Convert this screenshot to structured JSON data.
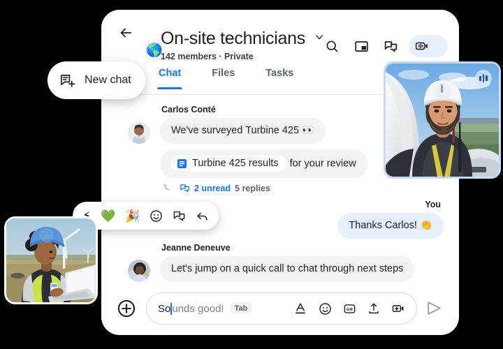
{
  "header": {
    "back_icon": "arrow-left-icon",
    "space_emoji": "🌎",
    "title": "On-site technicians",
    "subtitle": "142 members · Private",
    "caret_icon": "chevron-down-icon",
    "actions": [
      {
        "name": "search-icon",
        "label": "Search"
      },
      {
        "name": "picture-in-picture-icon",
        "label": "Picture in picture"
      },
      {
        "name": "open-in-thread-icon",
        "label": "Threads"
      },
      {
        "name": "video-call-icon",
        "label": "Start a call"
      }
    ]
  },
  "tabs": [
    {
      "label": "Chat",
      "active": true
    },
    {
      "label": "Files",
      "active": false
    },
    {
      "label": "Tasks",
      "active": false
    }
  ],
  "messages": [
    {
      "sender": "Carlos Conté",
      "avatar": "carlos-avatar",
      "text": "We've surveyed Turbine 425 👀"
    },
    {
      "doc_chip": "Turbine 425 results",
      "doc_icon": "google-docs-icon",
      "trailing_text": "for your review"
    },
    {
      "sender": "You",
      "text": "Thanks Carlos! 👏",
      "outgoing": true
    },
    {
      "sender": "Jeanne Deneuve",
      "avatar": "jeanne-avatar",
      "text": "Let's jump on a quick call to chat through next steps"
    }
  ],
  "thread": {
    "icon": "thread-icon",
    "unread": "2 unread",
    "replies": "5 replies"
  },
  "composer": {
    "add_icon": "plus-circle-icon",
    "typed_text": "So",
    "suggestion_text": "unds good!",
    "tab_hint": "Tab",
    "icons": [
      {
        "name": "format-text-icon",
        "label": "Formatting"
      },
      {
        "name": "emoji-icon",
        "label": "Emoji"
      },
      {
        "name": "gif-icon",
        "label": "GIF"
      },
      {
        "name": "upload-icon",
        "label": "Upload file"
      },
      {
        "name": "add-video-icon",
        "label": "Add video meeting"
      }
    ],
    "send_icon": "send-icon"
  },
  "new_chat_button": {
    "icon": "new-chat-icon",
    "label": "New chat"
  },
  "reaction_bar": [
    {
      "name": "lightning-reaction",
      "glyph": "⚡"
    },
    {
      "name": "green-heart-reaction",
      "glyph": "💚"
    },
    {
      "name": "party-popper-reaction",
      "glyph": "🎉"
    },
    {
      "name": "add-emoji-icon",
      "glyph": ""
    },
    {
      "name": "reply-in-thread-icon",
      "glyph": ""
    },
    {
      "name": "reply-arrow-icon",
      "glyph": ""
    }
  ],
  "video_tiles": [
    {
      "name": "technician-video-tile",
      "badge": "audio-waveform-icon"
    },
    {
      "name": "field-engineer-video-tile",
      "badge": ""
    }
  ],
  "colors": {
    "accent_blue": "#1a73e8",
    "bubble_gray": "#f1f3f4",
    "bubble_blue": "#e8f0fe",
    "tile_border": "#c6dafc"
  }
}
